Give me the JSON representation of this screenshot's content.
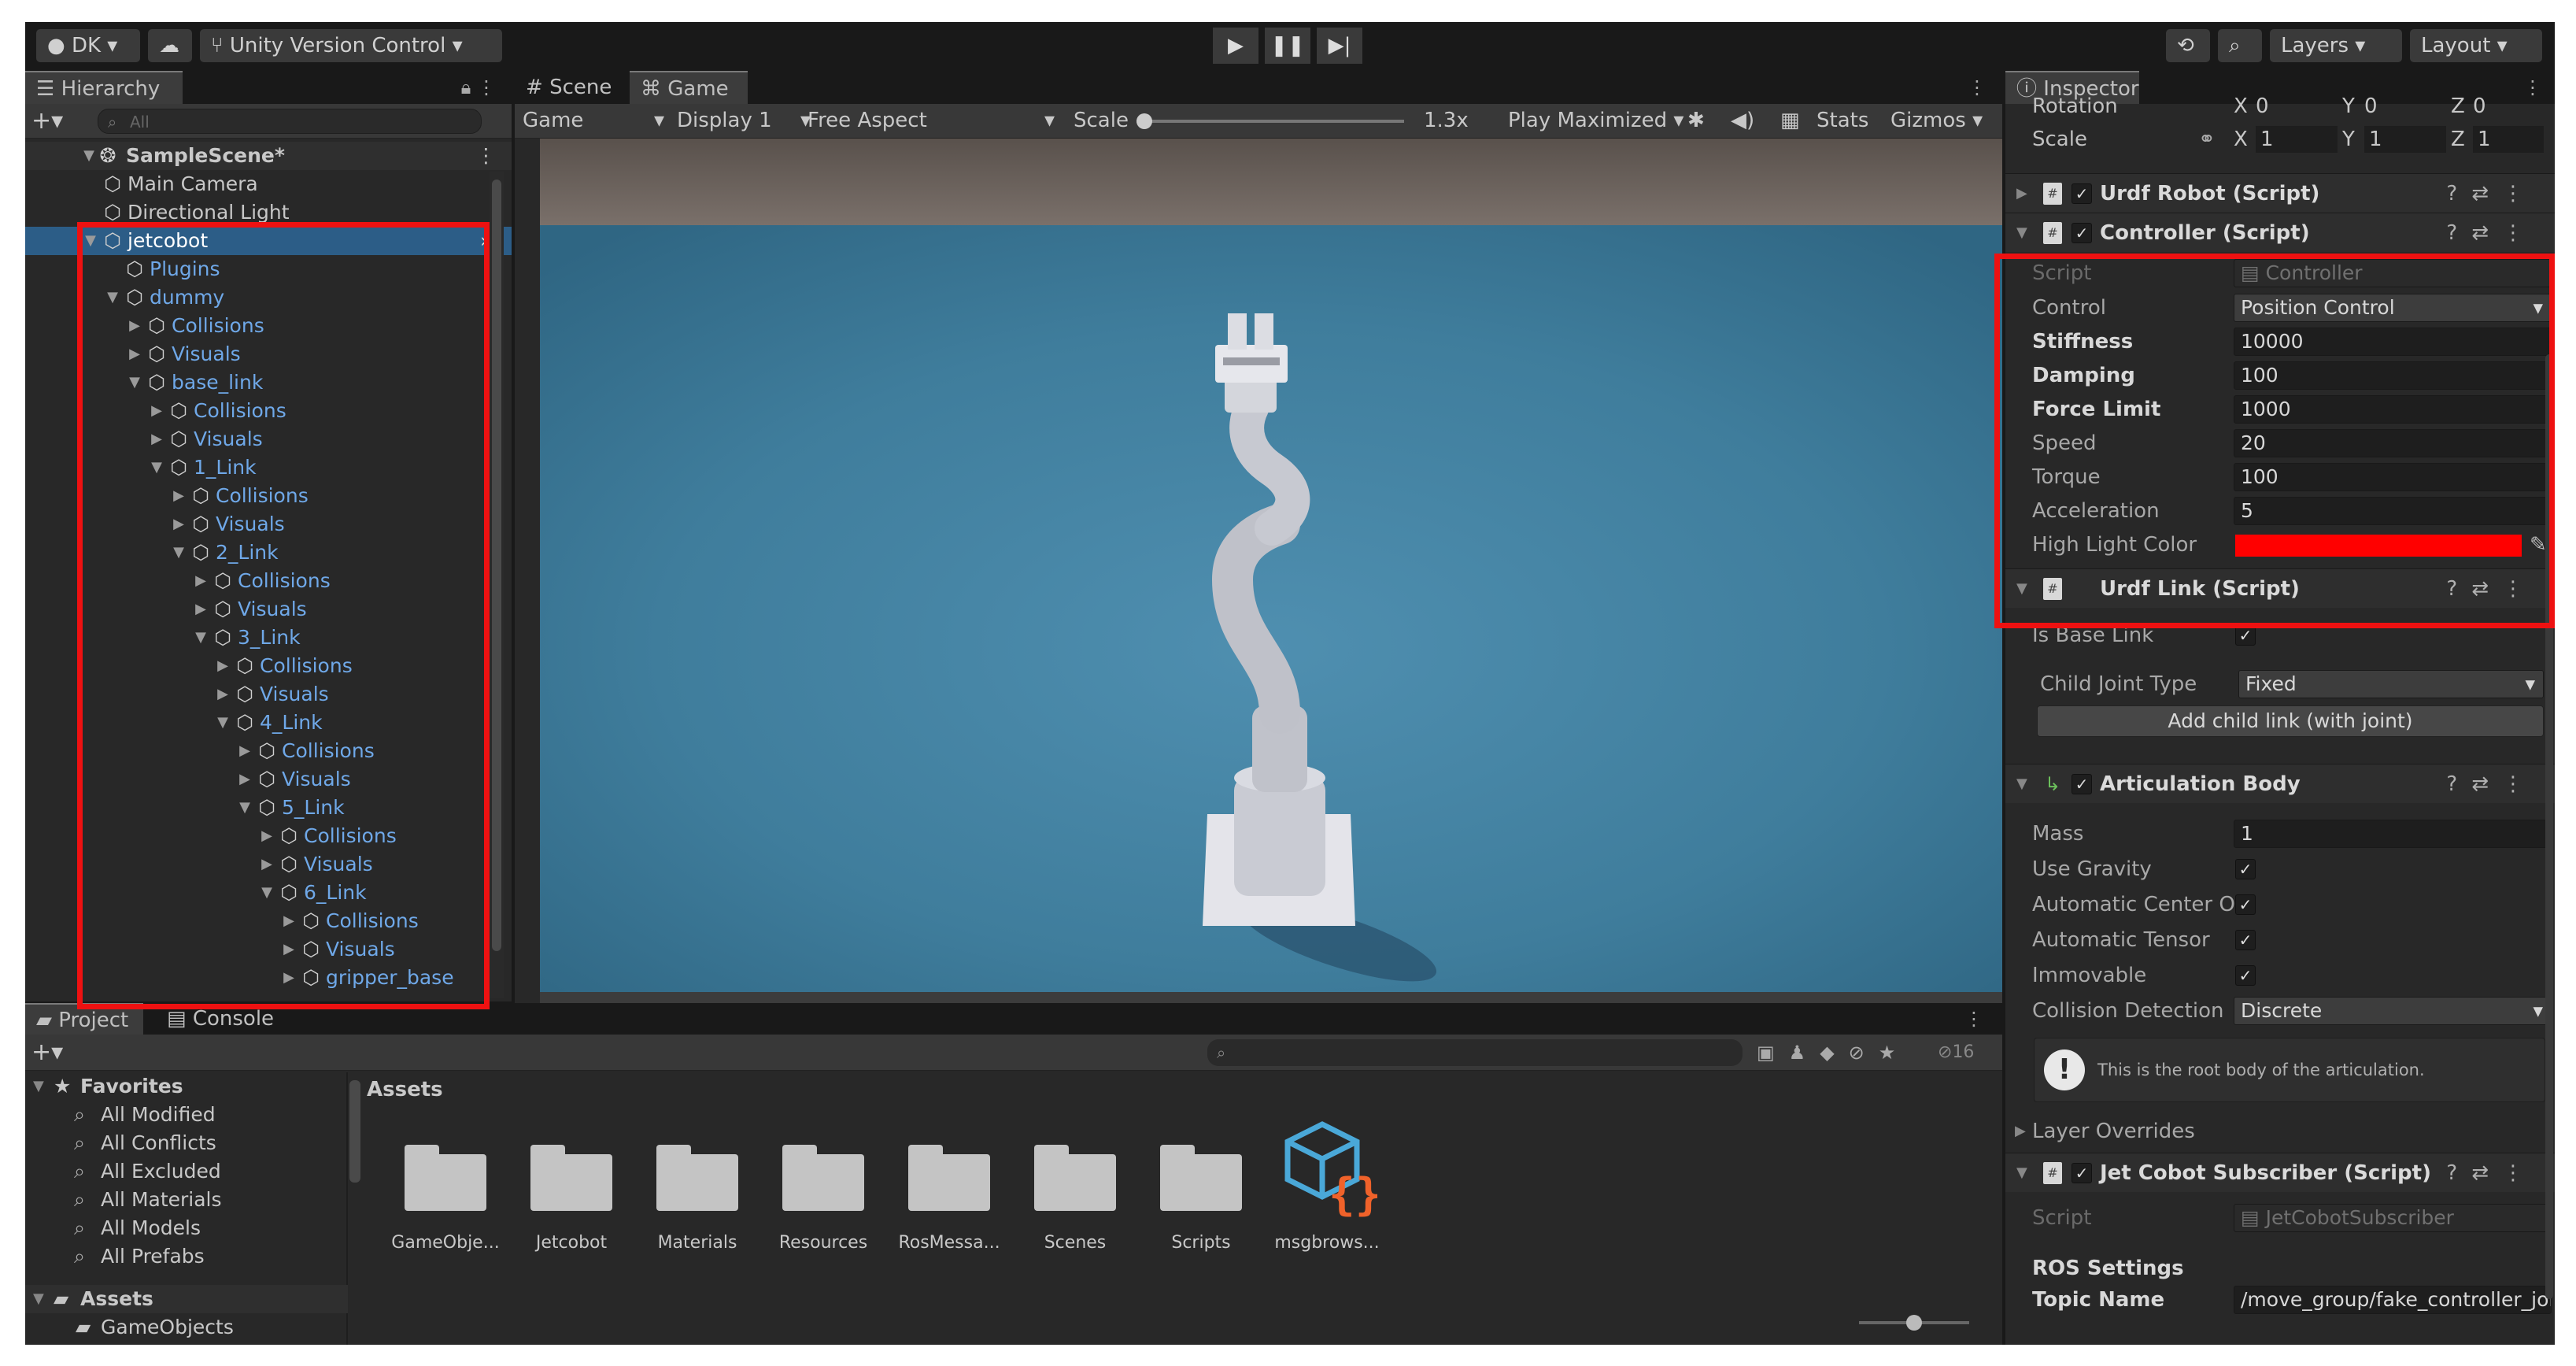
{
  "toolbar": {
    "account": "DK",
    "version_control": "Unity Version Control",
    "layers": "Layers",
    "layout": "Layout"
  },
  "hierarchy": {
    "tab": "Hierarchy",
    "search_placeholder": "All",
    "scene": "SampleScene*",
    "items": [
      {
        "label": "Main Camera"
      },
      {
        "label": "Directional Light"
      },
      {
        "label": "jetcobot"
      },
      {
        "label": "Plugins"
      },
      {
        "label": "dummy"
      },
      {
        "label": "Collisions"
      },
      {
        "label": "Visuals"
      },
      {
        "label": "base_link"
      },
      {
        "label": "Collisions"
      },
      {
        "label": "Visuals"
      },
      {
        "label": "1_Link"
      },
      {
        "label": "Collisions"
      },
      {
        "label": "Visuals"
      },
      {
        "label": "2_Link"
      },
      {
        "label": "Collisions"
      },
      {
        "label": "Visuals"
      },
      {
        "label": "3_Link"
      },
      {
        "label": "Collisions"
      },
      {
        "label": "Visuals"
      },
      {
        "label": "4_Link"
      },
      {
        "label": "Collisions"
      },
      {
        "label": "Visuals"
      },
      {
        "label": "5_Link"
      },
      {
        "label": "Collisions"
      },
      {
        "label": "Visuals"
      },
      {
        "label": "6_Link"
      },
      {
        "label": "Collisions"
      },
      {
        "label": "Visuals"
      },
      {
        "label": "gripper_base"
      }
    ]
  },
  "view": {
    "tab_scene": "Scene",
    "tab_game": "Game",
    "mode": "Game",
    "display": "Display 1",
    "aspect": "Free Aspect",
    "scale_label": "Scale",
    "scale_value": "1.3x",
    "play_mode": "Play Maximized",
    "stats": "Stats",
    "gizmos": "Gizmos"
  },
  "inspector": {
    "tab": "Inspector",
    "transform": {
      "rotation_label": "Rotation",
      "rot_x": "0",
      "rot_y": "0",
      "rot_z": "0",
      "scale_label": "Scale",
      "scale_x": "1",
      "scale_y": "1",
      "scale_z": "1",
      "x": "X",
      "y": "Y",
      "z": "Z"
    },
    "urdf_robot": "Urdf Robot (Script)",
    "controller": {
      "title": "Controller (Script)",
      "script_label": "Script",
      "script_value": "Controller",
      "control_label": "Control",
      "control_value": "Position Control",
      "stiffness_label": "Stiffness",
      "stiffness_value": "10000",
      "damping_label": "Damping",
      "damping_value": "100",
      "force_label": "Force Limit",
      "force_value": "1000",
      "speed_label": "Speed",
      "speed_value": "20",
      "torque_label": "Torque",
      "torque_value": "100",
      "accel_label": "Acceleration",
      "accel_value": "5",
      "highlight_label": "High Light Color",
      "highlight_color": "#ff0000"
    },
    "urdf_link": {
      "title": "Urdf Link (Script)",
      "base_label": "Is Base Link",
      "joint_label": "Child Joint Type",
      "joint_value": "Fixed",
      "add_child": "Add child link (with joint)"
    },
    "articulation": {
      "title": "Articulation Body",
      "mass_label": "Mass",
      "mass_value": "1",
      "gravity_label": "Use Gravity",
      "center_label": "Automatic Center Of",
      "tensor_label": "Automatic Tensor",
      "immovable_label": "Immovable",
      "collision_label": "Collision Detection",
      "collision_value": "Discrete",
      "info": "This is the root body of the articulation.",
      "overrides": "Layer Overrides"
    },
    "subscriber": {
      "title": "Jet Cobot Subscriber (Script)",
      "script_label": "Script",
      "script_value": "JetCobotSubscriber",
      "ros_settings": "ROS Settings",
      "topic_label": "Topic Name",
      "topic_value": "/move_group/fake_controller_joi"
    }
  },
  "project": {
    "tab_project": "Project",
    "tab_console": "Console",
    "hidden_count": "16",
    "favorites_title": "Favorites",
    "favorites": [
      "All Modified",
      "All Conflicts",
      "All Excluded",
      "All Materials",
      "All Models",
      "All Prefabs"
    ],
    "assets_root": "Assets",
    "assets_child": "GameObjects",
    "breadcrumb": "Assets",
    "folders": [
      "GameObje...",
      "Jetcobot",
      "Materials",
      "Resources",
      "RosMessa...",
      "Scenes",
      "Scripts",
      "msgbrows..."
    ]
  },
  "colors": {
    "highlight_box": "#ee1111",
    "link_blue": "#6fa8e8",
    "selection": "#2c5d87",
    "asset_icon_blue": "#4aa8d8",
    "asset_icon_orange": "#f0622a"
  }
}
